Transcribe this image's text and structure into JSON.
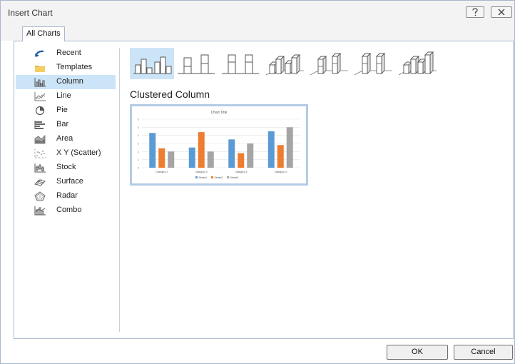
{
  "dialog": {
    "title": "Insert Chart",
    "tab": "All Charts",
    "ok_label": "OK",
    "cancel_label": "Cancel"
  },
  "sidebar": {
    "items": [
      {
        "label": "Recent",
        "icon": "recent-icon",
        "selected": false
      },
      {
        "label": "Templates",
        "icon": "templates-folder-icon",
        "selected": false
      },
      {
        "label": "Column",
        "icon": "column-chart-icon",
        "selected": true
      },
      {
        "label": "Line",
        "icon": "line-chart-icon",
        "selected": false
      },
      {
        "label": "Pie",
        "icon": "pie-chart-icon",
        "selected": false
      },
      {
        "label": "Bar",
        "icon": "bar-chart-icon",
        "selected": false
      },
      {
        "label": "Area",
        "icon": "area-chart-icon",
        "selected": false
      },
      {
        "label": "X Y (Scatter)",
        "icon": "scatter-chart-icon",
        "selected": false
      },
      {
        "label": "Stock",
        "icon": "stock-chart-icon",
        "selected": false
      },
      {
        "label": "Surface",
        "icon": "surface-chart-icon",
        "selected": false
      },
      {
        "label": "Radar",
        "icon": "radar-chart-icon",
        "selected": false
      },
      {
        "label": "Combo",
        "icon": "combo-chart-icon",
        "selected": false
      }
    ]
  },
  "subtypes": {
    "selected_index": 0,
    "items": [
      "clustered-column-icon",
      "stacked-column-icon",
      "100-stacked-column-icon",
      "3d-clustered-column-icon",
      "3d-stacked-column-icon",
      "3d-100-stacked-column-icon",
      "3d-column-icon"
    ],
    "selected_name": "Clustered Column"
  },
  "preview": {
    "title": "Chart Title",
    "series_colors": [
      "#5b9bd5",
      "#ed7d31",
      "#a5a5a5"
    ],
    "chart_data": {
      "type": "bar",
      "title": "Chart Title",
      "categories": [
        "Category 1",
        "Category 2",
        "Category 3",
        "Category 4"
      ],
      "series": [
        {
          "name": "Series1",
          "values": [
            4.3,
            2.5,
            3.5,
            4.5
          ]
        },
        {
          "name": "Series2",
          "values": [
            2.4,
            4.4,
            1.8,
            2.8
          ]
        },
        {
          "name": "Series3",
          "values": [
            2,
            2,
            3,
            5
          ]
        }
      ],
      "ylim": [
        0,
        6
      ],
      "yticks": [
        "0",
        "1",
        "2",
        "3",
        "4",
        "5",
        "6"
      ],
      "grid": true,
      "legend": "bottom"
    }
  }
}
